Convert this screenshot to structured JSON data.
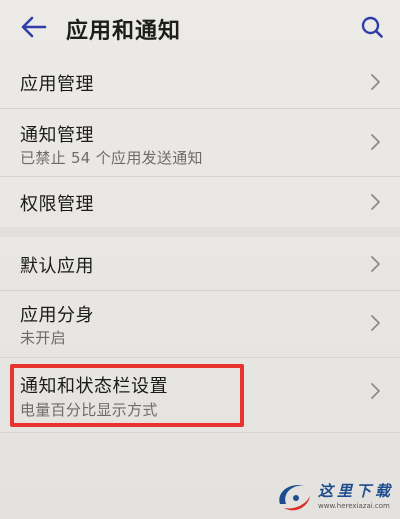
{
  "header": {
    "title": "应用和通知"
  },
  "menu": [
    {
      "title": "应用管理",
      "subtitle": ""
    },
    {
      "title": "通知管理",
      "subtitle": "已禁止 54 个应用发送通知"
    },
    {
      "title": "权限管理",
      "subtitle": ""
    },
    {
      "title": "默认应用",
      "subtitle": ""
    },
    {
      "title": "应用分身",
      "subtitle": "未开启"
    },
    {
      "title": "通知和状态栏设置",
      "subtitle": "电量百分比显示方式"
    }
  ],
  "watermark": {
    "name": "这里下载",
    "url": "www.herexiazai.com"
  },
  "colors": {
    "accent": "#2f3ea8",
    "highlight": "#e8332f",
    "watermark": "#1d4d8f"
  },
  "icons": {
    "back": "arrow-left-icon",
    "search": "search-icon",
    "chevron": "chevron-right-icon"
  }
}
